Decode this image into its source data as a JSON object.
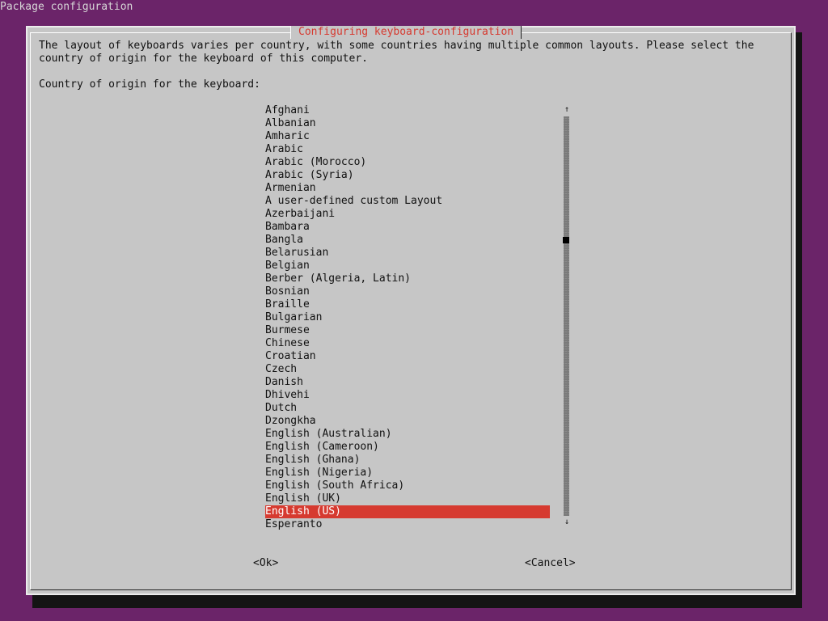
{
  "screen": {
    "title": "Package configuration"
  },
  "dialog": {
    "title": "Configuring keyboard-configuration",
    "description_line1": "The layout of keyboards varies per country, with some countries having multiple common layouts. Please select the",
    "description_line2": "country of origin for the keyboard of this computer.",
    "prompt": "Country of origin for the keyboard:",
    "selected_value": "English (US)"
  },
  "list": {
    "items": [
      "Afghani",
      "Albanian",
      "Amharic",
      "Arabic",
      "Arabic (Morocco)",
      "Arabic (Syria)",
      "Armenian",
      "A user-defined custom Layout",
      "Azerbaijani",
      "Bambara",
      "Bangla",
      "Belarusian",
      "Belgian",
      "Berber (Algeria, Latin)",
      "Bosnian",
      "Braille",
      "Bulgarian",
      "Burmese",
      "Chinese",
      "Croatian",
      "Czech",
      "Danish",
      "Dhivehi",
      "Dutch",
      "Dzongkha",
      "English (Australian)",
      "English (Cameroon)",
      "English (Ghana)",
      "English (Nigeria)",
      "English (South Africa)",
      "English (UK)",
      "English (US)",
      "Esperanto"
    ],
    "scroll_up_icon": "↑",
    "scroll_down_icon": "↓"
  },
  "buttons": {
    "ok": "<Ok>",
    "cancel": "<Cancel>"
  },
  "colors": {
    "desktop_background": "#6b2469",
    "dialog_background": "#c6c6c6",
    "title_red": "#d63a30",
    "selection_red": "#d63a30"
  }
}
